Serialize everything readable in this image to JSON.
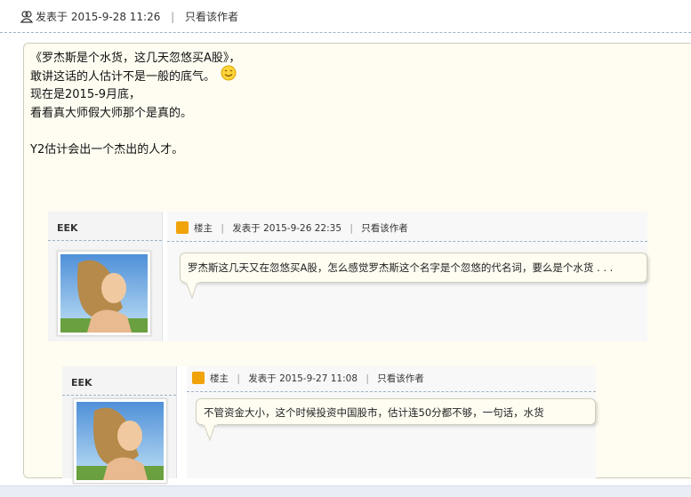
{
  "post": {
    "meta_prefix": "发表于",
    "timestamp": "2015-9-28 11:26",
    "separator": "|",
    "only_author": "只看该作者"
  },
  "quote": {
    "lines": [
      "《罗杰斯是个水货，这几天忽悠买A股》，",
      "敢讲这话的人估计不是一般的底气。",
      "现在是2015-9月底，",
      "看看真大师假大师那个是真的。",
      "",
      "Y2估计会出一个杰出的人才。"
    ]
  },
  "embedded_posts": [
    {
      "author": "EEK",
      "role": "楼主",
      "separator": "|",
      "meta_prefix": "发表于",
      "timestamp": "2015-9-26 22:35",
      "only_author": "只看该作者",
      "content": "罗杰斯这几天又在忽悠买A股，怎么感觉罗杰斯这个名字是个忽悠的代名词，要么是个水货 . . ."
    },
    {
      "author": "EEK",
      "role": "楼主",
      "separator": "|",
      "meta_prefix": "发表于",
      "timestamp": "2015-9-27 11:08",
      "only_author": "只看该作者",
      "content": "不管资金大小，这个时候投资中国股市，估计连50分都不够，一句话，水货"
    }
  ],
  "colors": {
    "quote_bg": "#fffdf1",
    "dashed_rule": "#9db3c8",
    "louzhu_icon": "#f0a30a"
  }
}
